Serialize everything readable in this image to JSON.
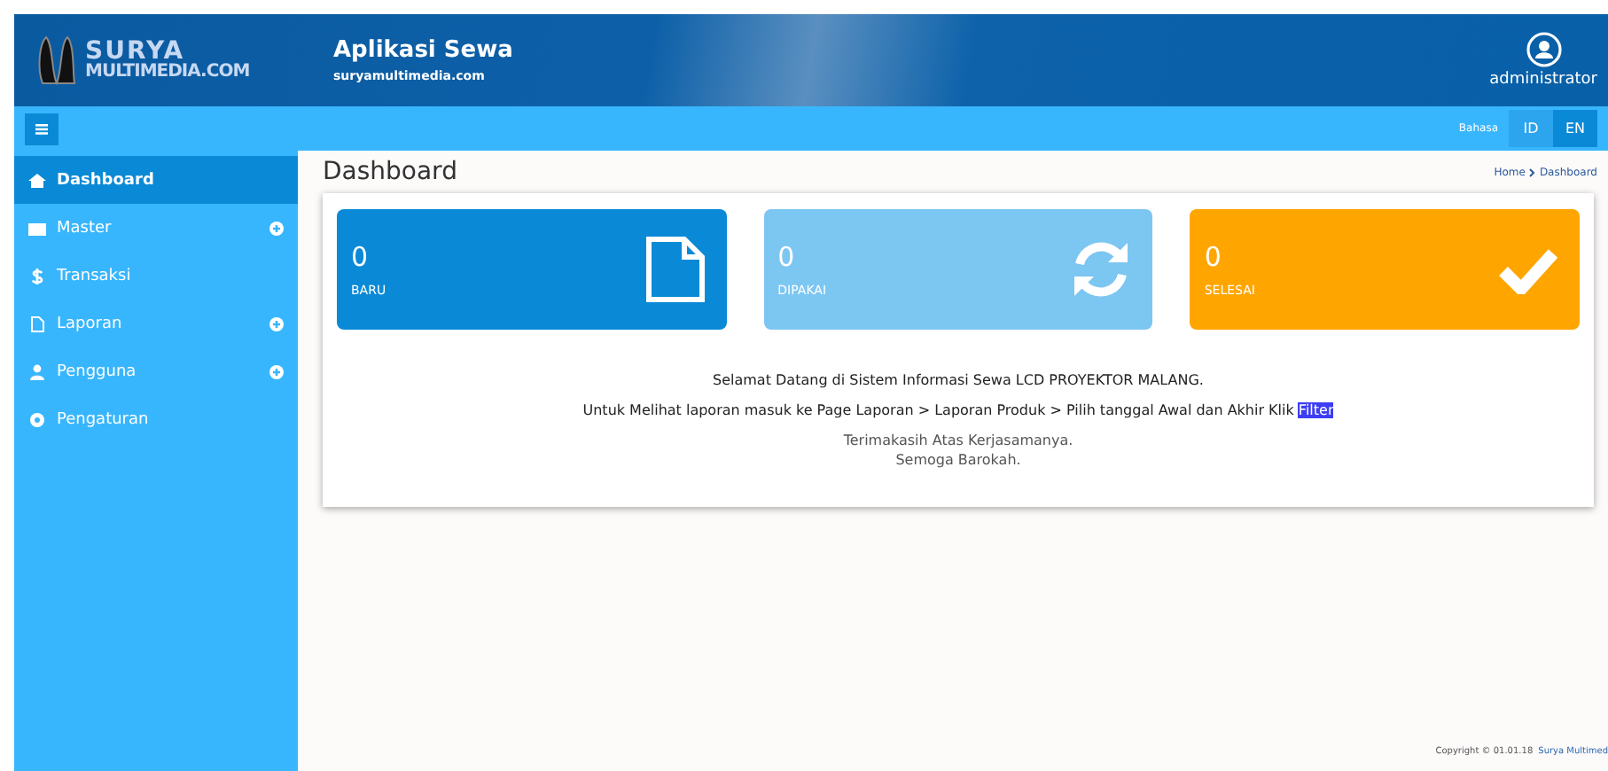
{
  "header": {
    "logo": [
      "SURYA",
      "MULTIMEDIA.COM"
    ],
    "app_title": "Aplikasi Sewa",
    "app_subtitle": "suryamultimedia.com",
    "user": "administrator"
  },
  "toolbar": {
    "language_label": "Bahasa",
    "languages": [
      {
        "label": "ID",
        "selected": false
      },
      {
        "label": "EN",
        "selected": true
      }
    ]
  },
  "sidebar": {
    "items": [
      {
        "label": "Dashboard",
        "kind": "home",
        "selected": true,
        "expandable": false
      },
      {
        "label": "Master",
        "kind": "card",
        "selected": false,
        "expandable": true
      },
      {
        "label": "Transaksi",
        "kind": "dollar",
        "selected": false,
        "expandable": false
      },
      {
        "label": "Laporan",
        "kind": "file",
        "selected": false,
        "expandable": true
      },
      {
        "label": "Pengguna",
        "kind": "user",
        "selected": false,
        "expandable": true
      },
      {
        "label": "Pengaturan",
        "kind": "gear",
        "selected": false,
        "expandable": false
      }
    ]
  },
  "page": {
    "title": "Dashboard",
    "breadcrumb": [
      "Home",
      "Dashboard"
    ]
  },
  "stats": [
    {
      "value": "0",
      "label": "BARU",
      "kind": "file",
      "color": "#0a8ad6"
    },
    {
      "value": "0",
      "label": "DIPAKAI",
      "kind": "refresh",
      "color": "#7cc6f2"
    },
    {
      "value": "0",
      "label": "SELESAI",
      "kind": "check",
      "color": "#ffa500"
    }
  ],
  "welcome": {
    "line1": "Selamat Datang di Sistem Informasi Sewa LCD PROYEKTOR MALANG.",
    "line2": "Untuk Melihat laporan masuk ke Page Laporan > Laporan Produk > Pilih tanggal Awal dan Akhir Klik",
    "line2_highlight": "Filter",
    "thanks": "Terimakasih Atas Kerjasamanya.",
    "blessing": "Semoga Barokah."
  },
  "footer": {
    "copyright": "Copyright © 01.01.18",
    "link": "Surya Multimed"
  }
}
